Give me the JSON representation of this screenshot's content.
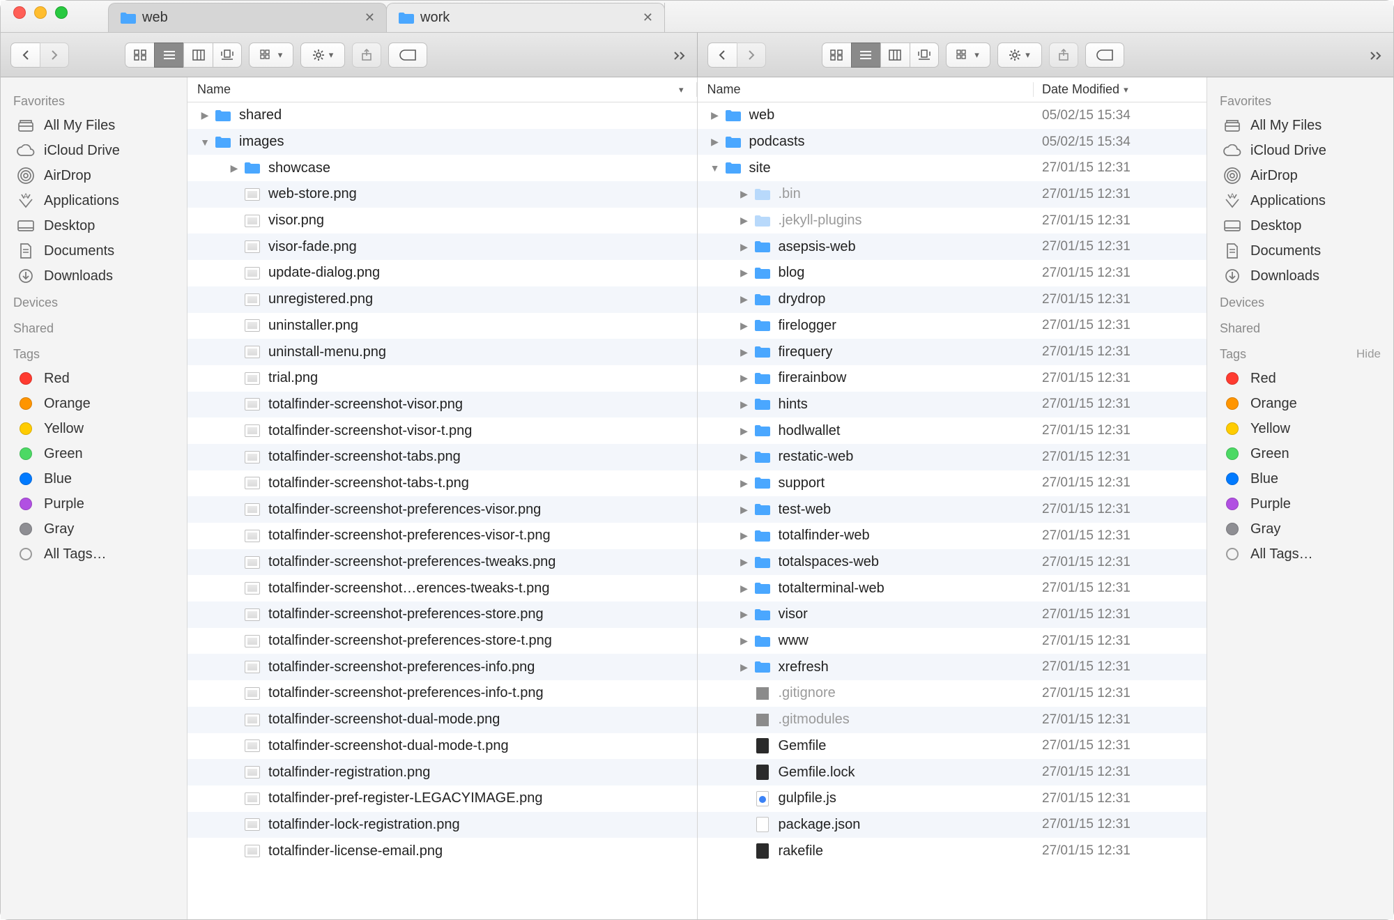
{
  "tabs": [
    {
      "title": "web",
      "active": true
    },
    {
      "title": "work",
      "active": false
    }
  ],
  "sidebar": {
    "favorites_label": "Favorites",
    "devices_label": "Devices",
    "shared_label": "Shared",
    "tags_label": "Tags",
    "hide_label": "Hide",
    "favorites": [
      {
        "icon": "all-my-files",
        "label": "All My Files"
      },
      {
        "icon": "icloud",
        "label": "iCloud Drive"
      },
      {
        "icon": "airdrop",
        "label": "AirDrop"
      },
      {
        "icon": "applications",
        "label": "Applications"
      },
      {
        "icon": "desktop",
        "label": "Desktop"
      },
      {
        "icon": "documents",
        "label": "Documents"
      },
      {
        "icon": "downloads",
        "label": "Downloads"
      }
    ],
    "tags": [
      {
        "color": "#ff3b30",
        "label": "Red"
      },
      {
        "color": "#ff9500",
        "label": "Orange"
      },
      {
        "color": "#ffcc00",
        "label": "Yellow"
      },
      {
        "color": "#4cd964",
        "label": "Green"
      },
      {
        "color": "#007aff",
        "label": "Blue"
      },
      {
        "color": "#b150e2",
        "label": "Purple"
      },
      {
        "color": "#8e8e93",
        "label": "Gray"
      }
    ],
    "all_tags_label": "All Tags…"
  },
  "columns": {
    "name": "Name",
    "date": "Date Modified"
  },
  "left_rows": [
    {
      "depth": 0,
      "disc": "right",
      "type": "folder",
      "name": "shared"
    },
    {
      "depth": 0,
      "disc": "down",
      "type": "folder",
      "name": "images"
    },
    {
      "depth": 1,
      "disc": "right",
      "type": "folder",
      "name": "showcase"
    },
    {
      "depth": 1,
      "type": "png",
      "name": "web-store.png"
    },
    {
      "depth": 1,
      "type": "png",
      "name": "visor.png"
    },
    {
      "depth": 1,
      "type": "png",
      "name": "visor-fade.png"
    },
    {
      "depth": 1,
      "type": "png",
      "name": "update-dialog.png"
    },
    {
      "depth": 1,
      "type": "png",
      "name": "unregistered.png"
    },
    {
      "depth": 1,
      "type": "png",
      "name": "uninstaller.png"
    },
    {
      "depth": 1,
      "type": "png",
      "name": "uninstall-menu.png"
    },
    {
      "depth": 1,
      "type": "png",
      "name": "trial.png"
    },
    {
      "depth": 1,
      "type": "png",
      "name": "totalfinder-screenshot-visor.png"
    },
    {
      "depth": 1,
      "type": "png",
      "name": "totalfinder-screenshot-visor-t.png"
    },
    {
      "depth": 1,
      "type": "png",
      "name": "totalfinder-screenshot-tabs.png"
    },
    {
      "depth": 1,
      "type": "png",
      "name": "totalfinder-screenshot-tabs-t.png"
    },
    {
      "depth": 1,
      "type": "png",
      "name": "totalfinder-screenshot-preferences-visor.png"
    },
    {
      "depth": 1,
      "type": "png",
      "name": "totalfinder-screenshot-preferences-visor-t.png"
    },
    {
      "depth": 1,
      "type": "png",
      "name": "totalfinder-screenshot-preferences-tweaks.png"
    },
    {
      "depth": 1,
      "type": "png",
      "name": "totalfinder-screenshot…erences-tweaks-t.png"
    },
    {
      "depth": 1,
      "type": "png",
      "name": "totalfinder-screenshot-preferences-store.png"
    },
    {
      "depth": 1,
      "type": "png",
      "name": "totalfinder-screenshot-preferences-store-t.png"
    },
    {
      "depth": 1,
      "type": "png",
      "name": "totalfinder-screenshot-preferences-info.png"
    },
    {
      "depth": 1,
      "type": "png",
      "name": "totalfinder-screenshot-preferences-info-t.png"
    },
    {
      "depth": 1,
      "type": "png",
      "name": "totalfinder-screenshot-dual-mode.png"
    },
    {
      "depth": 1,
      "type": "png",
      "name": "totalfinder-screenshot-dual-mode-t.png"
    },
    {
      "depth": 1,
      "type": "png",
      "name": "totalfinder-registration.png"
    },
    {
      "depth": 1,
      "type": "png",
      "name": "totalfinder-pref-register-LEGACYIMAGE.png"
    },
    {
      "depth": 1,
      "type": "png",
      "name": "totalfinder-lock-registration.png"
    },
    {
      "depth": 1,
      "type": "png",
      "name": "totalfinder-license-email.png"
    }
  ],
  "right_rows": [
    {
      "depth": 0,
      "disc": "right",
      "type": "folder",
      "name": "web",
      "date": "05/02/15 15:34"
    },
    {
      "depth": 0,
      "disc": "right",
      "type": "folder",
      "name": "podcasts",
      "date": "05/02/15 15:34"
    },
    {
      "depth": 0,
      "disc": "down",
      "type": "folder",
      "name": "site",
      "date": "27/01/15 12:31"
    },
    {
      "depth": 1,
      "disc": "right",
      "type": "folder-dim",
      "name": ".bin",
      "dim": true,
      "date": "27/01/15 12:31"
    },
    {
      "depth": 1,
      "disc": "right",
      "type": "folder-dim",
      "name": ".jekyll-plugins",
      "dim": true,
      "date": "27/01/15 12:31"
    },
    {
      "depth": 1,
      "disc": "right",
      "type": "folder",
      "name": "asepsis-web",
      "date": "27/01/15 12:31"
    },
    {
      "depth": 1,
      "disc": "right",
      "type": "folder",
      "name": "blog",
      "date": "27/01/15 12:31"
    },
    {
      "depth": 1,
      "disc": "right",
      "type": "folder",
      "name": "drydrop",
      "date": "27/01/15 12:31"
    },
    {
      "depth": 1,
      "disc": "right",
      "type": "folder",
      "name": "firelogger",
      "date": "27/01/15 12:31"
    },
    {
      "depth": 1,
      "disc": "right",
      "type": "folder",
      "name": "firequery",
      "date": "27/01/15 12:31"
    },
    {
      "depth": 1,
      "disc": "right",
      "type": "folder",
      "name": "firerainbow",
      "date": "27/01/15 12:31"
    },
    {
      "depth": 1,
      "disc": "right",
      "type": "folder",
      "name": "hints",
      "date": "27/01/15 12:31"
    },
    {
      "depth": 1,
      "disc": "right",
      "type": "folder",
      "name": "hodlwallet",
      "date": "27/01/15 12:31"
    },
    {
      "depth": 1,
      "disc": "right",
      "type": "folder",
      "name": "restatic-web",
      "date": "27/01/15 12:31"
    },
    {
      "depth": 1,
      "disc": "right",
      "type": "folder",
      "name": "support",
      "date": "27/01/15 12:31"
    },
    {
      "depth": 1,
      "disc": "right",
      "type": "folder",
      "name": "test-web",
      "date": "27/01/15 12:31"
    },
    {
      "depth": 1,
      "disc": "right",
      "type": "folder",
      "name": "totalfinder-web",
      "date": "27/01/15 12:31"
    },
    {
      "depth": 1,
      "disc": "right",
      "type": "folder",
      "name": "totalspaces-web",
      "date": "27/01/15 12:31"
    },
    {
      "depth": 1,
      "disc": "right",
      "type": "folder",
      "name": "totalterminal-web",
      "date": "27/01/15 12:31"
    },
    {
      "depth": 1,
      "disc": "right",
      "type": "folder",
      "name": "visor",
      "date": "27/01/15 12:31"
    },
    {
      "depth": 1,
      "disc": "right",
      "type": "folder",
      "name": "www",
      "date": "27/01/15 12:31"
    },
    {
      "depth": 1,
      "disc": "right",
      "type": "folder",
      "name": "xrefresh",
      "date": "27/01/15 12:31"
    },
    {
      "depth": 1,
      "type": "grey",
      "name": ".gitignore",
      "dim": true,
      "date": "27/01/15 12:31"
    },
    {
      "depth": 1,
      "type": "grey",
      "name": ".gitmodules",
      "dim": true,
      "date": "27/01/15 12:31"
    },
    {
      "depth": 1,
      "type": "dark",
      "name": "Gemfile",
      "date": "27/01/15 12:31"
    },
    {
      "depth": 1,
      "type": "dark",
      "name": "Gemfile.lock",
      "date": "27/01/15 12:31"
    },
    {
      "depth": 1,
      "type": "js",
      "name": "gulpfile.js",
      "date": "27/01/15 12:31"
    },
    {
      "depth": 1,
      "type": "file",
      "name": "package.json",
      "date": "27/01/15 12:31"
    },
    {
      "depth": 1,
      "type": "dark",
      "name": "rakefile",
      "date": "27/01/15 12:31"
    }
  ]
}
